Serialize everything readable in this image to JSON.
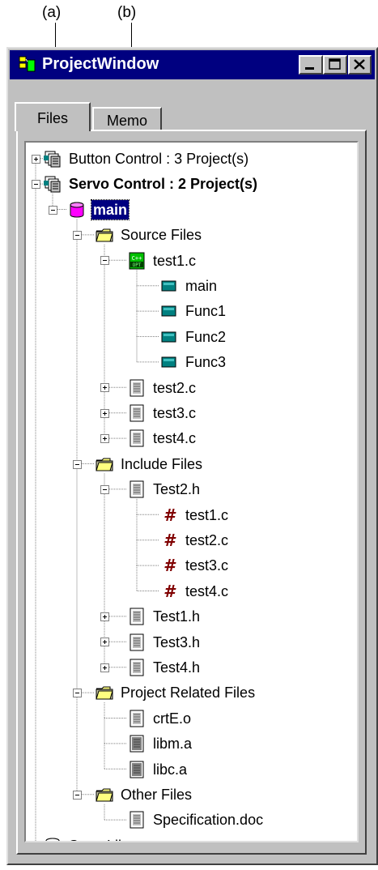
{
  "callouts": [
    {
      "label": "(a)"
    },
    {
      "label": "(b)"
    }
  ],
  "window": {
    "title": "ProjectWindow",
    "controls": [
      "minimize-icon",
      "maximize-icon",
      "close-icon"
    ]
  },
  "tabs": [
    {
      "label": "Files",
      "active": true
    },
    {
      "label": "Memo",
      "active": false
    }
  ],
  "tree": [
    {
      "label": "Button Control : 3 Project(s)",
      "icon": "workspace-icon",
      "expander": "plus"
    },
    {
      "label": "Servo Control : 2 Project(s)",
      "icon": "workspace-icon",
      "expander": "minus",
      "bold": true
    },
    {
      "label": "main",
      "icon": "project-cylinder-icon",
      "expander": "minus",
      "selected": true
    },
    {
      "label": "Source Files",
      "icon": "folder-icon",
      "expander": "minus"
    },
    {
      "label": "test1.c",
      "icon": "opt-source-icon",
      "expander": "minus"
    },
    {
      "label": "main",
      "icon": "function-icon"
    },
    {
      "label": "Func1",
      "icon": "function-icon"
    },
    {
      "label": "Func2",
      "icon": "function-icon"
    },
    {
      "label": "Func3",
      "icon": "function-icon"
    },
    {
      "label": "test2.c",
      "icon": "file-icon",
      "expander": "plus"
    },
    {
      "label": "test3.c",
      "icon": "file-icon",
      "expander": "plus"
    },
    {
      "label": "test4.c",
      "icon": "file-icon",
      "expander": "plus"
    },
    {
      "label": "Include Files",
      "icon": "folder-icon",
      "expander": "minus"
    },
    {
      "label": "Test2.h",
      "icon": "file-icon",
      "expander": "minus"
    },
    {
      "label": "test1.c",
      "icon": "include-hash-icon"
    },
    {
      "label": "test2.c",
      "icon": "include-hash-icon"
    },
    {
      "label": "test3.c",
      "icon": "include-hash-icon"
    },
    {
      "label": "test4.c",
      "icon": "include-hash-icon"
    },
    {
      "label": "Test1.h",
      "icon": "file-icon",
      "expander": "plus"
    },
    {
      "label": "Test3.h",
      "icon": "file-icon",
      "expander": "plus"
    },
    {
      "label": "Test4.h",
      "icon": "file-icon",
      "expander": "plus"
    },
    {
      "label": "Project Related Files",
      "icon": "folder-icon",
      "expander": "minus"
    },
    {
      "label": "crtE.o",
      "icon": "file-icon"
    },
    {
      "label": "libm.a",
      "icon": "library-file-icon"
    },
    {
      "label": "libc.a",
      "icon": "library-file-icon"
    },
    {
      "label": "Other Files",
      "icon": "folder-icon",
      "expander": "minus"
    },
    {
      "label": "Specification.doc",
      "icon": "file-icon"
    },
    {
      "label": "ServoLibrary",
      "icon": "library-cylinder-icon",
      "expander": "plus"
    }
  ],
  "colors": {
    "titlebar": "#000080",
    "selection": "#000080",
    "function_icon": "#008080",
    "hash_icon": "#800000",
    "project_cylinder": "#ff00ff",
    "folder": "#ffff80"
  }
}
